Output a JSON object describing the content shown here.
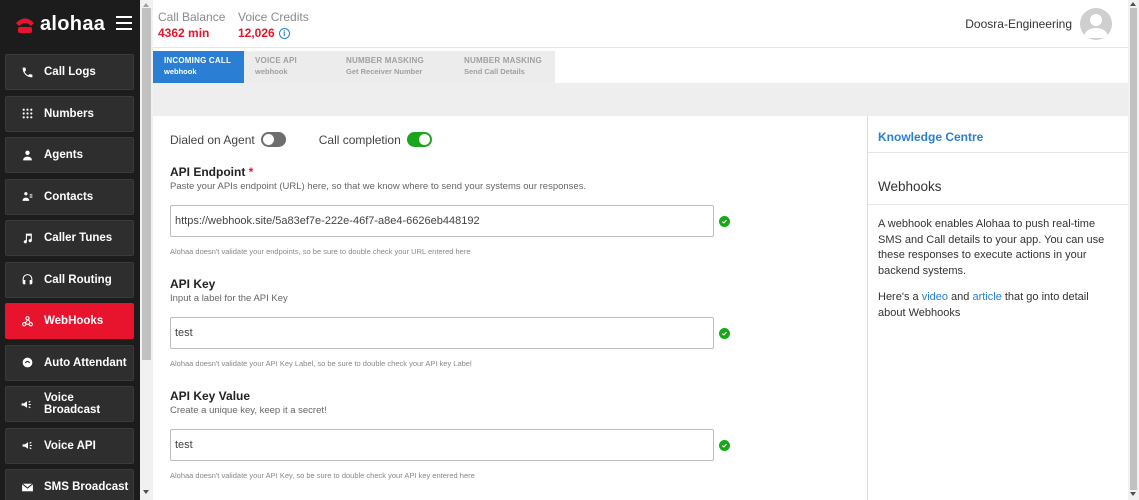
{
  "app": {
    "brand": "alohaa"
  },
  "sidebar": {
    "items": [
      {
        "label": "Call Logs",
        "icon": "phone-icon"
      },
      {
        "label": "Numbers",
        "icon": "dialpad-icon"
      },
      {
        "label": "Agents",
        "icon": "person-icon"
      },
      {
        "label": "Contacts",
        "icon": "contacts-icon"
      },
      {
        "label": "Caller Tunes",
        "icon": "music-note-icon"
      },
      {
        "label": "Call Routing",
        "icon": "headset-icon"
      },
      {
        "label": "WebHooks",
        "icon": "webhook-icon",
        "active": true
      },
      {
        "label": "Auto Attendant",
        "icon": "attendant-icon"
      },
      {
        "label": "Voice Broadcast",
        "icon": "megaphone-icon"
      },
      {
        "label": "Voice API",
        "icon": "megaphone-icon"
      },
      {
        "label": "SMS Broadcast",
        "icon": "mail-icon"
      }
    ]
  },
  "header": {
    "call_balance_label": "Call Balance",
    "call_balance_value": "4362 min",
    "voice_credits_label": "Voice Credits",
    "voice_credits_value": "12,026",
    "info_glyph": "i",
    "user_name": "Doosra-Engineering"
  },
  "tabs": [
    {
      "title": "INCOMING CALL",
      "subtitle": "webhook",
      "active": true
    },
    {
      "title": "VOICE API",
      "subtitle": "webhook"
    },
    {
      "title": "NUMBER MASKING",
      "subtitle": "Get Receiver Number"
    },
    {
      "title": "NUMBER MASKING",
      "subtitle": "Send Call Details"
    }
  ],
  "form": {
    "dialed_on_agent_label": "Dialed on Agent",
    "dialed_on_agent_on": false,
    "call_completion_label": "Call completion",
    "call_completion_on": true,
    "endpoint": {
      "title": "API Endpoint",
      "required_mark": "*",
      "subtitle": "Paste your APIs endpoint (URL) here, so that we know where to send your systems our responses.",
      "value": "https://webhook.site/5a83ef7e-222e-46f7-a8e4-6626eb448192",
      "note": "Alohaa doesn't validate your endpoints, so be sure to double check your URL entered here"
    },
    "api_key": {
      "title": "API Key",
      "subtitle": "Input a label for the API Key",
      "value": "test",
      "note": "Alohaa doesn't validate your API Key Label, so be sure to double check your API key Label"
    },
    "api_key_value": {
      "title": "API Key Value",
      "subtitle": "Create a unique key, keep it a secret!",
      "value": "test",
      "note": "Alohaa doesn't validate your API Key, so be sure to double check your API key entered here"
    }
  },
  "knowledge": {
    "header": "Knowledge Centre",
    "title": "Webhooks",
    "body": "A webhook enables Alohaa to push real-time SMS and Call details to your app. You can use these responses to execute actions in your backend systems.",
    "more_prefix": "Here's a",
    "video_link": "video",
    "and": "and",
    "article_link": "article",
    "more_suffix": "that go into detail about Webhooks"
  },
  "colors": {
    "brand_red": "#e8132c",
    "link_blue": "#2a7fd4",
    "success_green": "#1aa61a"
  }
}
